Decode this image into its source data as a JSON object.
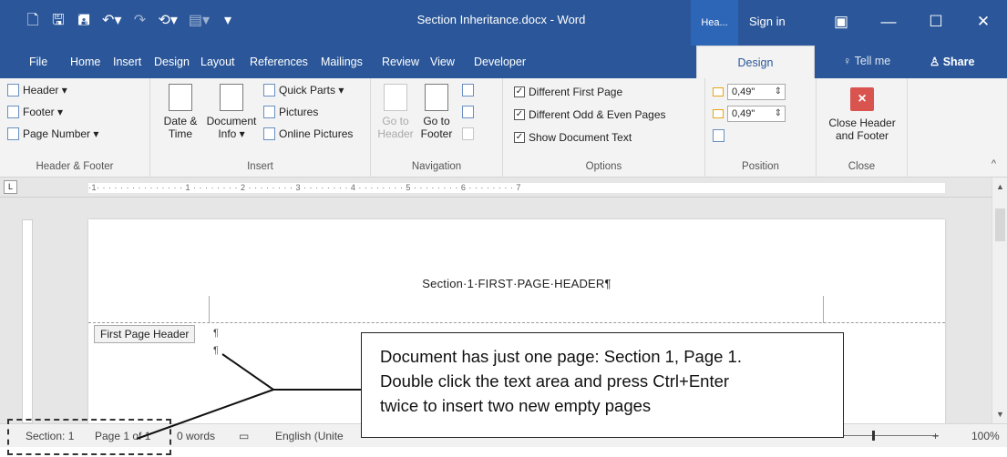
{
  "titlebar": {
    "title": "Section Inheritance.docx  -  Word",
    "context_tab": "Hea...",
    "sign_in": "Sign in",
    "qat_icons": [
      "new-document-icon",
      "save-icon",
      "save-as-icon",
      "undo-icon",
      "redo-icon",
      "repeat-icon",
      "paint-icon",
      "customize-icon"
    ]
  },
  "tabs": [
    "File",
    "Home",
    "Insert",
    "Design",
    "Layout",
    "References",
    "Mailings",
    "Review",
    "View",
    "Developer"
  ],
  "active_tab": "Design",
  "tell_me": "Tell me",
  "share": "Share",
  "ribbon": {
    "header_footer": {
      "header": "Header ▾",
      "footer": "Footer ▾",
      "page_number": "Page Number ▾",
      "label": "Header & Footer"
    },
    "insert": {
      "date_time_1": "Date &",
      "date_time_2": "Time",
      "doc_info_1": "Document",
      "doc_info_2": "Info ▾",
      "quick_parts": "Quick Parts ▾",
      "pictures": "Pictures",
      "online_pictures": "Online Pictures",
      "label": "Insert"
    },
    "navigation": {
      "goto_header_1": "Go to",
      "goto_header_2": "Header",
      "goto_footer_1": "Go to",
      "goto_footer_2": "Footer",
      "label": "Navigation"
    },
    "options": {
      "diff_first": "Different First Page",
      "diff_odd_even": "Different Odd & Even Pages",
      "show_doc_text": "Show Document Text",
      "label": "Options"
    },
    "position": {
      "header_from_top": "0,49\"",
      "footer_from_bottom": "0,49\"",
      "label": "Position"
    },
    "close": {
      "close_1": "Close Header",
      "close_2": "and Footer",
      "label": "Close"
    }
  },
  "ruler": {
    "corner": "L",
    "marks": "·1· · · · · · · ·  · · · · · · · 1 · · · · · · · · 2 · · · · · · · · 3 · · · · · · · · 4 · · · · · · · · 5 · · · · · · · · 6 · · · · · · · · 7"
  },
  "document": {
    "header_text": "Section·1·FIRST·PAGE·HEADER¶",
    "header_tag": "First Page Header",
    "pilcrow": "¶"
  },
  "statusbar": {
    "section": "Section: 1",
    "page": "Page 1 of 1",
    "words": "0 words",
    "language": "English (Unite",
    "zoom": "100%",
    "zoom_minus": "−",
    "zoom_plus": "+"
  },
  "callout": {
    "line1": "Document has just one page: Section 1, Page 1.",
    "line2": "Double click the text area and press Ctrl+Enter",
    "line3": "twice to insert two new empty pages"
  },
  "colors": {
    "word_blue": "#2b579a",
    "ribbon_bg": "#f3f3f3",
    "workspace_bg": "#e6e6e6",
    "close_red": "#d9534f"
  }
}
